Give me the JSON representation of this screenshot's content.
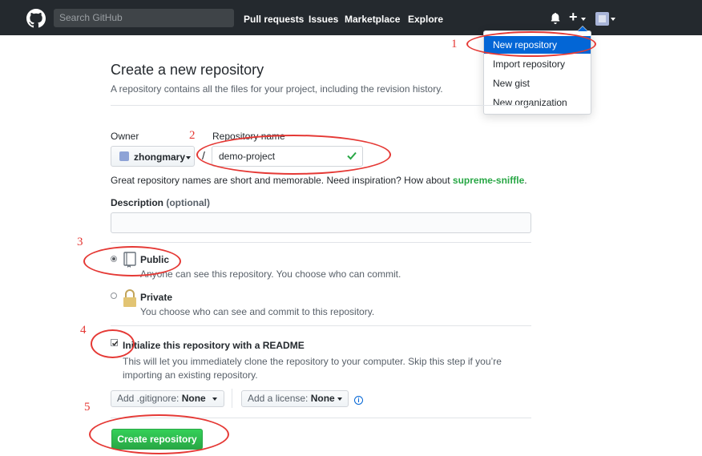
{
  "header": {
    "search_placeholder": "Search GitHub",
    "nav": [
      "Pull requests",
      "Issues",
      "Marketplace",
      "Explore"
    ],
    "plus": "+"
  },
  "dropdown": {
    "items": [
      "New repository",
      "Import repository",
      "New gist",
      "New organization"
    ]
  },
  "page": {
    "title": "Create a new repository",
    "subtitle": "A repository contains all the files for your project, including the revision history."
  },
  "form": {
    "owner_label": "Owner",
    "repo_label": "Repository name",
    "owner_value": "zhongmary",
    "slash": "/",
    "repo_value": "demo-project",
    "hint_prefix": "Great repository names are short and memorable. Need inspiration? How about ",
    "hint_suggestion": "supreme-sniffle",
    "hint_suffix": ".",
    "description_label": "Description",
    "description_optional": "(optional)",
    "public_title": "Public",
    "public_desc": "Anyone can see this repository. You choose who can commit.",
    "private_title": "Private",
    "private_desc": "You choose who can see and commit to this repository.",
    "readme_title": "Initialize this repository with a README",
    "readme_desc": "This will let you immediately clone the repository to your computer. Skip this step if you’re importing an existing repository.",
    "gitignore_label": "Add .gitignore:",
    "gitignore_value": "None",
    "license_label": "Add a license:",
    "license_value": "None",
    "info_glyph": "i",
    "create_button": "Create repository"
  },
  "annotations": [
    "1",
    "2",
    "3",
    "4",
    "5"
  ],
  "colors": {
    "header_bg": "#24292e",
    "accent": "#0366d6",
    "success": "#28a745",
    "annotation": "#e53935"
  }
}
